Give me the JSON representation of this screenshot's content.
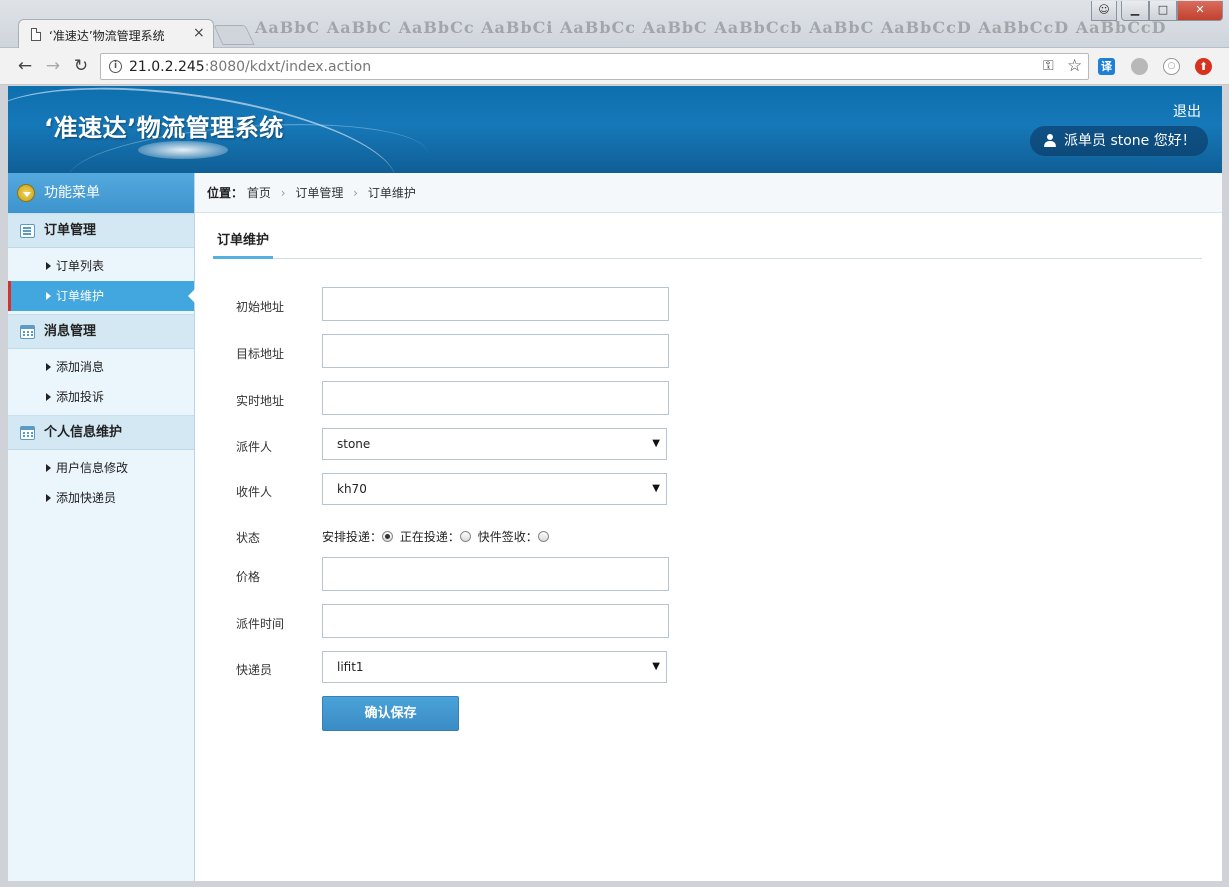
{
  "browser": {
    "tab_title": "‘准速达’物流管理系统",
    "tab_close": "×",
    "url_host": "21.0.2.245",
    "url_rest": ":8080/kdxt/index.action",
    "ghost_ribbon": "AaBbC  AaBbC  AaBbCc  AaBbCi  AaBbCc  AaBbC  AaBbCcb  AaBbC  AaBbCcD  AaBbCcD  AaBbCcD",
    "ext_translate": "译"
  },
  "header": {
    "system_title": "‘准速达’物流管理系统",
    "logout_label": "退出",
    "welcome_text": "派单员  stone 您好！"
  },
  "sidebar": {
    "menu_title": "功能菜单",
    "groups": [
      {
        "label": "订单管理",
        "items": [
          {
            "label": "订单列表"
          },
          {
            "label": "订单维护",
            "active": true
          }
        ]
      },
      {
        "label": "消息管理",
        "items": [
          {
            "label": "添加消息"
          },
          {
            "label": "添加投诉"
          }
        ]
      },
      {
        "label": "个人信息维护",
        "items": [
          {
            "label": "用户信息修改"
          },
          {
            "label": "添加快递员"
          }
        ]
      }
    ]
  },
  "breadcrumb": {
    "label": "位置：",
    "items": [
      "首页",
      "订单管理",
      "订单维护"
    ]
  },
  "section_title": "订单维护",
  "form": {
    "start_address_label": "初始地址",
    "start_address_value": "",
    "target_address_label": "目标地址",
    "target_address_value": "",
    "current_address_label": "实时地址",
    "current_address_value": "",
    "dispatcher_label": "派件人",
    "dispatcher_value": "stone",
    "receiver_label": "收件人",
    "receiver_value": "kh70",
    "status_label": "状态",
    "status_options": [
      "安排投递：",
      "正在投递：",
      "快件签收："
    ],
    "status_selected": 0,
    "price_label": "价格",
    "price_value": "",
    "dispatch_time_label": "派件时间",
    "dispatch_time_value": "",
    "courier_label": "快递员",
    "courier_value": "lifit1",
    "save_label": "确认保存"
  }
}
